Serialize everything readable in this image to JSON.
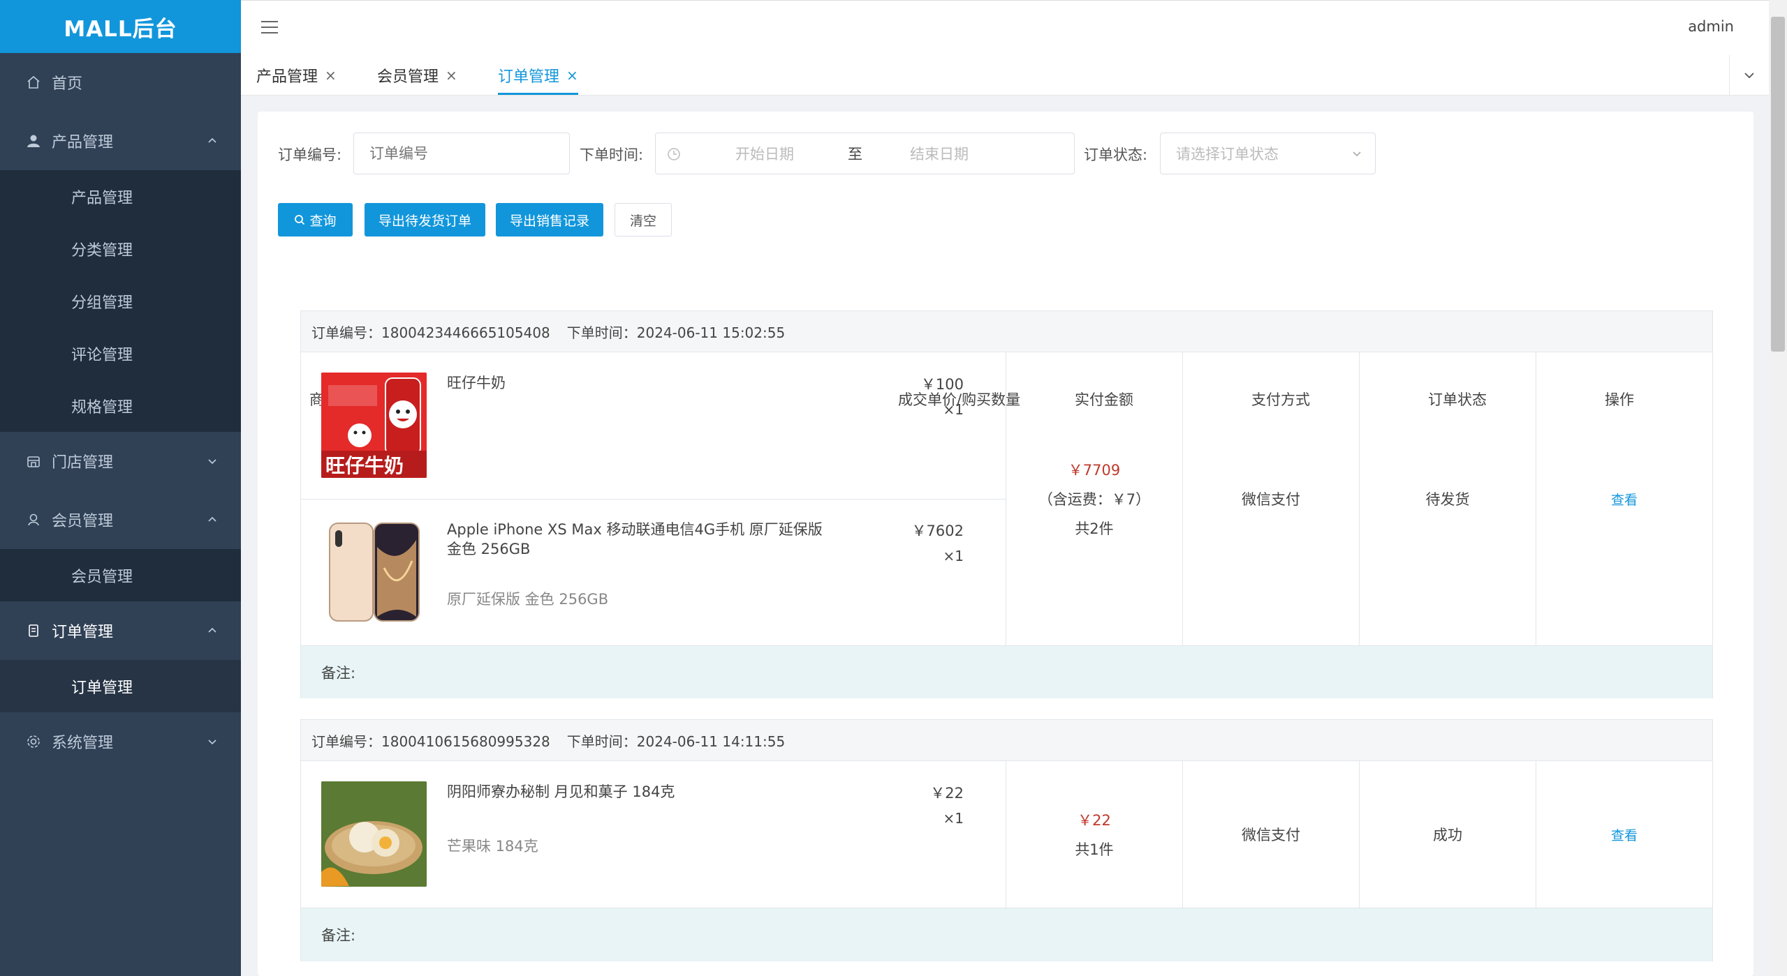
{
  "app": {
    "brand": "MALL后台",
    "user": "admin"
  },
  "sidebar": {
    "home": "首页",
    "product": {
      "label": "产品管理",
      "items": [
        "产品管理",
        "分类管理",
        "分组管理",
        "评论管理",
        "规格管理"
      ]
    },
    "store": "门店管理",
    "member": {
      "label": "会员管理",
      "items": [
        "会员管理"
      ]
    },
    "order": {
      "label": "订单管理",
      "items": [
        "订单管理"
      ]
    },
    "system": "系统管理"
  },
  "tabs": [
    {
      "label": "产品管理",
      "active": false
    },
    {
      "label": "会员管理",
      "active": false
    },
    {
      "label": "订单管理",
      "active": true
    }
  ],
  "filters": {
    "order_no_label": "订单编号:",
    "order_no_placeholder": "订单编号",
    "time_label": "下单时间:",
    "start_placeholder": "开始日期",
    "range_sep": "至",
    "end_placeholder": "结束日期",
    "status_label": "订单状态:",
    "status_placeholder": "请选择订单状态"
  },
  "buttons": {
    "search": "查询",
    "export_pending": "导出待发货订单",
    "export_sales": "导出销售记录",
    "clear": "清空"
  },
  "table_headers": {
    "goods": "商品",
    "price_qty": "成交单价/购买数量",
    "paid": "实付金额",
    "pay_method": "支付方式",
    "status": "订单状态",
    "action": "操作"
  },
  "orders": [
    {
      "no_label": "订单编号：1800423446665105408",
      "time_label": "下单时间：2024-06-11 15:02:55",
      "items": [
        {
          "name": "旺仔牛奶",
          "spec": "",
          "price": "￥100",
          "qty": "×1"
        },
        {
          "name": "Apple iPhone XS Max 移动联通电信4G手机 原厂延保版 金色 256GB",
          "spec": "原厂延保版 金色 256GB",
          "price": "￥7602",
          "qty": "×1"
        }
      ],
      "amount": "￥7709",
      "freight": "（含运费：￥7）",
      "count": "共2件",
      "pay_method": "微信支付",
      "status": "待发货",
      "action": "查看",
      "remark": "备注:"
    },
    {
      "no_label": "订单编号：1800410615680995328",
      "time_label": "下单时间：2024-06-11 14:11:55",
      "items": [
        {
          "name": "阴阳师寮办秘制 月见和菓子 184克",
          "spec": "芒果味 184克",
          "price": "￥22",
          "qty": "×1"
        }
      ],
      "amount": "￥22",
      "count": "共1件",
      "pay_method": "微信支付",
      "status": "成功",
      "action": "查看",
      "remark": "备注:"
    }
  ]
}
